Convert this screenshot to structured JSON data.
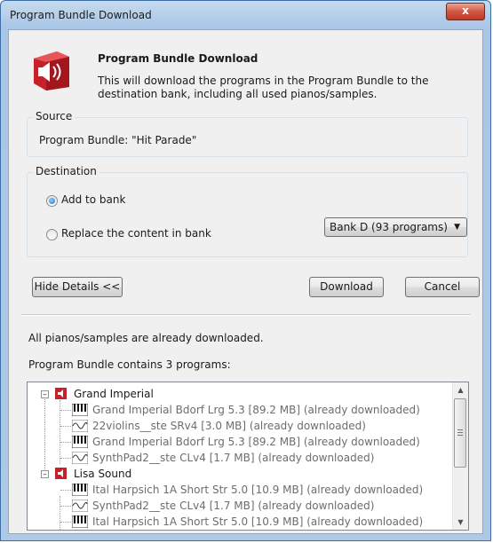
{
  "window": {
    "title": "Program Bundle Download",
    "close_label": "x"
  },
  "header": {
    "title": "Program Bundle Download",
    "description": "This will download the programs in the Program Bundle to the destination bank, including all used pianos/samples."
  },
  "source": {
    "label": "Source",
    "text": "Program Bundle: \"Hit Parade\""
  },
  "destination": {
    "label": "Destination",
    "add_to_bank": "Add to bank",
    "replace_content": "Replace the content in bank",
    "selected_option": "add_to_bank",
    "bank_select": "Bank D (93 programs)"
  },
  "buttons": {
    "hide_details": "Hide Details <<",
    "download": "Download",
    "cancel": "Cancel"
  },
  "details": {
    "status": "All pianos/samples are already downloaded.",
    "contains": "Program Bundle contains 3 programs:"
  },
  "tree": {
    "programs": [
      {
        "name": "Grand Imperial",
        "items": [
          {
            "type": "piano",
            "text": "Grand Imperial Bdorf Lrg 5.3 [89.2 MB] (already downloaded)"
          },
          {
            "type": "wave",
            "text": "22violins__ste SRv4 [3.0 MB] (already downloaded)"
          },
          {
            "type": "piano",
            "text": "Grand Imperial Bdorf Lrg 5.3 [89.2 MB] (already downloaded)"
          },
          {
            "type": "wave",
            "text": "SynthPad2__ste CLv4 [1.7 MB] (already downloaded)"
          }
        ]
      },
      {
        "name": "Lisa Sound",
        "items": [
          {
            "type": "piano",
            "text": "Ital Harpsich 1A Short Str 5.0 [10.9 MB] (already downloaded)"
          },
          {
            "type": "wave",
            "text": "SynthPad2__ste CLv4 [1.7 MB] (already downloaded)"
          },
          {
            "type": "piano",
            "text": "Ital Harpsich 1A Short Str 5.0 [10.9 MB] (already downloaded)"
          }
        ]
      }
    ]
  },
  "colors": {
    "accent_red": "#c8202a",
    "title_bar": "#a9c6e6"
  }
}
